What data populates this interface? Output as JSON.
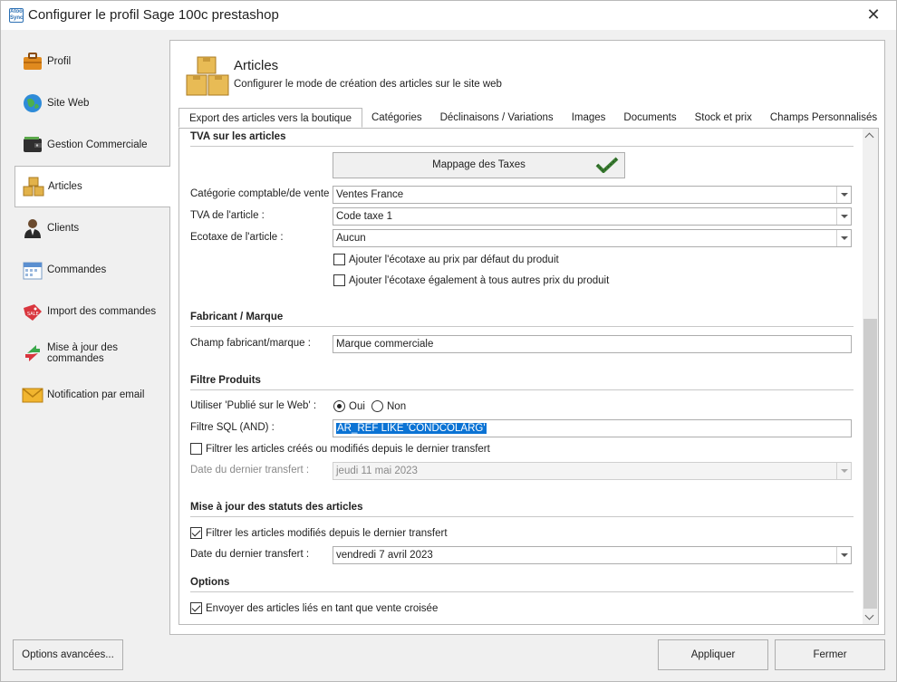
{
  "window": {
    "title": "Configurer le profil Sage 100c prestashop",
    "logo_text": "Atoo Sync"
  },
  "sidebar": {
    "items": [
      {
        "label": "Profil",
        "icon": "briefcase-icon"
      },
      {
        "label": "Site Web",
        "icon": "globe-icon"
      },
      {
        "label": "Gestion Commerciale",
        "icon": "wallet-icon"
      },
      {
        "label": "Articles",
        "icon": "boxes-icon",
        "active": true
      },
      {
        "label": "Clients",
        "icon": "person-icon"
      },
      {
        "label": "Commandes",
        "icon": "calendar-icon"
      },
      {
        "label": "Import des commandes",
        "icon": "sale-tag-icon"
      },
      {
        "label": "Mise à jour des commandes",
        "icon": "sync-arrows-icon"
      },
      {
        "label": "Notification par email",
        "icon": "envelope-icon"
      }
    ]
  },
  "header": {
    "title": "Articles",
    "subtitle": "Configurer le mode de création des articles sur le site web"
  },
  "tabs": [
    "Export des articles vers la boutique",
    "Catégories",
    "Déclinaisons / Variations",
    "Images",
    "Documents",
    "Stock et prix",
    "Champs Personnalisés"
  ],
  "tva": {
    "title": "TVA sur les articles",
    "mapping_button": "Mappage des Taxes",
    "categorie_label": "Catégorie comptable/de vente :",
    "categorie_value": "Ventes France",
    "tva_label": "TVA de l'article :",
    "tva_value": "Code taxe 1",
    "ecotaxe_label": "Ecotaxe de l'article :",
    "ecotaxe_value": "Aucun",
    "cb_ecotaxe_default": "Ajouter l'écotaxe au prix par défaut du produit",
    "cb_ecotaxe_all": "Ajouter l'écotaxe également à tous autres prix du produit"
  },
  "fabricant": {
    "title": "Fabricant / Marque",
    "field_label": "Champ fabricant/marque :",
    "field_value": "Marque commerciale"
  },
  "filtre": {
    "title": "Filtre Produits",
    "publie_label": "Utiliser 'Publié sur le Web' :",
    "radio_oui": "Oui",
    "radio_non": "Non",
    "sql_label": "Filtre SQL (AND) :",
    "sql_value": "AR_REF LIKE 'CONDCOLARG'",
    "cb_filter_label": "Filtrer les articles créés ou modifiés depuis le dernier transfert",
    "date_label": "Date du dernier transfert :",
    "date_value": "jeudi 11 mai 2023"
  },
  "statuts": {
    "title": "Mise à jour des statuts des articles",
    "cb_filter_label": "Filtrer les articles modifiés depuis le dernier transfert",
    "date_label": "Date du dernier transfert :",
    "date_value": "vendredi 7 avril 2023"
  },
  "options": {
    "title": "Options",
    "cb_cross_sell": "Envoyer des articles liés en tant que vente croisée"
  },
  "footer": {
    "advanced_button": "Options avancées...",
    "apply_button": "Appliquer",
    "close_button": "Fermer"
  },
  "colors": {
    "accent": "#0b73d4",
    "border": "#b9b9b9",
    "check_green": "#3a7d32"
  }
}
